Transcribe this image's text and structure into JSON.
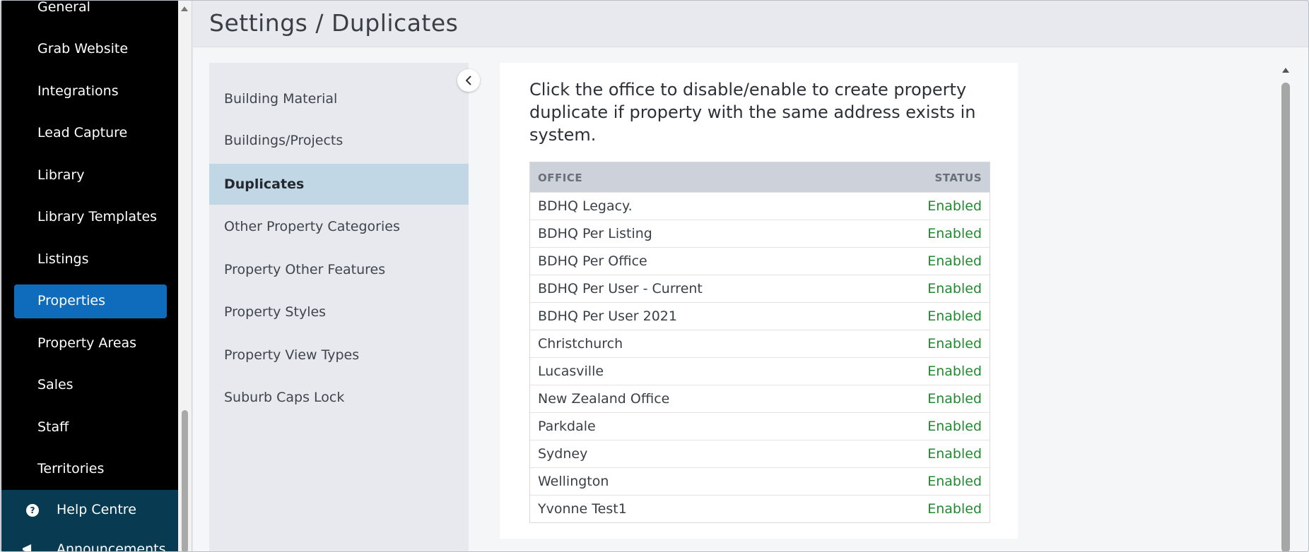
{
  "sidebar": {
    "items": [
      {
        "label": "General"
      },
      {
        "label": "Grab Website"
      },
      {
        "label": "Integrations"
      },
      {
        "label": "Lead Capture"
      },
      {
        "label": "Library"
      },
      {
        "label": "Library Templates"
      },
      {
        "label": "Listings"
      },
      {
        "label": "Properties",
        "active": true
      },
      {
        "label": "Property Areas"
      },
      {
        "label": "Sales"
      },
      {
        "label": "Staff"
      },
      {
        "label": "Territories"
      }
    ],
    "help_label": "Help Centre",
    "announcements_label": "Announcements"
  },
  "header": {
    "title": "Settings / Duplicates"
  },
  "submenu": {
    "items": [
      {
        "label": "Building Material"
      },
      {
        "label": "Buildings/Projects"
      },
      {
        "label": "Duplicates",
        "active": true
      },
      {
        "label": "Other Property Categories"
      },
      {
        "label": "Property Other Features"
      },
      {
        "label": "Property Styles"
      },
      {
        "label": "Property View Types"
      },
      {
        "label": "Suburb Caps Lock"
      }
    ]
  },
  "main": {
    "description": "Click the office to disable/enable to create property duplicate if property with the same address exists in system.",
    "table": {
      "headers": {
        "office": "OFFICE",
        "status": "STATUS"
      },
      "rows": [
        {
          "office": "BDHQ Legacy.",
          "status": "Enabled"
        },
        {
          "office": "BDHQ Per Listing",
          "status": "Enabled"
        },
        {
          "office": "BDHQ Per Office",
          "status": "Enabled"
        },
        {
          "office": "BDHQ Per User - Current",
          "status": "Enabled"
        },
        {
          "office": "BDHQ Per User 2021",
          "status": "Enabled"
        },
        {
          "office": "Christchurch",
          "status": "Enabled"
        },
        {
          "office": "Lucasville",
          "status": "Enabled"
        },
        {
          "office": "New Zealand Office",
          "status": "Enabled"
        },
        {
          "office": "Parkdale",
          "status": "Enabled"
        },
        {
          "office": "Sydney",
          "status": "Enabled"
        },
        {
          "office": "Wellington",
          "status": "Enabled"
        },
        {
          "office": "Yvonne Test1",
          "status": "Enabled"
        }
      ]
    }
  },
  "colors": {
    "sidebar_bg": "#000000",
    "active_nav": "#0f6cbd",
    "active_submenu": "#c2d7e6",
    "status_enabled": "#1f8a2e",
    "help_band": "#083a52"
  }
}
